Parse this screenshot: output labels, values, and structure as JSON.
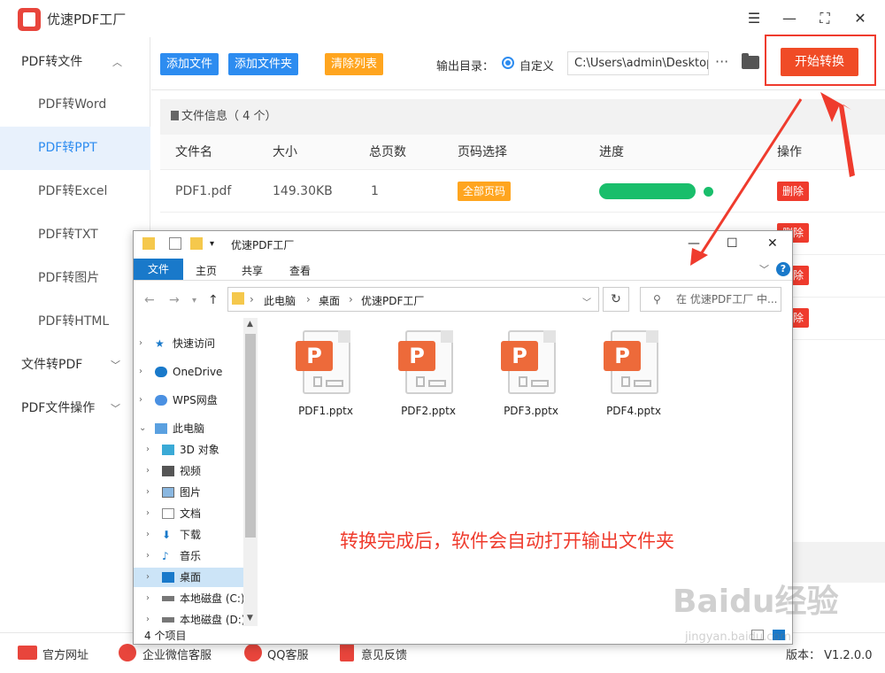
{
  "app": {
    "title": "优速PDF工厂",
    "accent": "#2d8cf0",
    "danger": "#ef3b2d"
  },
  "sidebar": {
    "groups": [
      {
        "label": "PDF转文件",
        "chevron": "chevron-up-icon"
      },
      {
        "label": "文件转PDF",
        "chevron": "chevron-down-icon"
      },
      {
        "label": "PDF文件操作",
        "chevron": "chevron-down-icon"
      }
    ],
    "items": [
      "PDF转Word",
      "PDF转PPT",
      "PDF转Excel",
      "PDF转TXT",
      "PDF转图片",
      "PDF转HTML"
    ],
    "active": "PDF转PPT"
  },
  "toolbar": {
    "add_file": "添加文件",
    "add_folder": "添加文件夹",
    "clear_list": "清除列表",
    "output_label": "输出目录：",
    "custom_label": "自定义",
    "output_path": "C:\\Users\\admin\\Desktop",
    "more": "···",
    "start": "开始转换"
  },
  "file_info": {
    "label": "文件信息（ 4 个）"
  },
  "table": {
    "headers": [
      "文件名",
      "大小",
      "总页数",
      "页码选择",
      "进度",
      "操作"
    ],
    "rows": [
      {
        "name": "PDF1.pdf",
        "size": "149.30KB",
        "pages": "1",
        "page_select": "全部页码",
        "progress": 1.0,
        "action": "删除"
      }
    ],
    "hidden_rows_actions": [
      "删除",
      "删除",
      "删除"
    ]
  },
  "bottombar": {
    "links": [
      "官方网址",
      "企业微信客服",
      "QQ客服",
      "意见反馈"
    ],
    "version": "版本： V1.2.0.0"
  },
  "explorer": {
    "title": "优速PDF工厂",
    "ribbon": {
      "file": "文件",
      "tabs": [
        "主页",
        "共享",
        "查看"
      ]
    },
    "address": [
      "此电脑",
      "桌面",
      "优速PDF工厂"
    ],
    "search_placeholder": "在 优速PDF工厂 中...",
    "nav": [
      {
        "label": "快速访问",
        "level": 0,
        "icon": "star-icon"
      },
      {
        "label": "OneDrive",
        "level": 0,
        "icon": "cloud-icon"
      },
      {
        "label": "WPS网盘",
        "level": 0,
        "icon": "cloud-icon"
      },
      {
        "label": "此电脑",
        "level": 0,
        "icon": "computer-icon",
        "expanded": true
      },
      {
        "label": "3D 对象",
        "level": 1,
        "icon": "cube-icon"
      },
      {
        "label": "视频",
        "level": 1,
        "icon": "video-icon"
      },
      {
        "label": "图片",
        "level": 1,
        "icon": "picture-icon"
      },
      {
        "label": "文档",
        "level": 1,
        "icon": "document-icon"
      },
      {
        "label": "下载",
        "level": 1,
        "icon": "download-icon"
      },
      {
        "label": "音乐",
        "level": 1,
        "icon": "music-icon"
      },
      {
        "label": "桌面",
        "level": 1,
        "icon": "desktop-icon",
        "selected": true
      },
      {
        "label": "本地磁盘 (C:)",
        "level": 1,
        "icon": "drive-icon"
      },
      {
        "label": "本地磁盘 (D:)",
        "level": 1,
        "icon": "drive-icon"
      }
    ],
    "files": [
      "PDF1.pptx",
      "PDF2.pptx",
      "PDF3.pptx",
      "PDF4.pptx"
    ],
    "file_icon_letter": "P",
    "status": "4 个项目",
    "notice": "转换完成后，软件会自动打开输出文件夹"
  },
  "watermark": {
    "text": "Baidu经验",
    "sub": "jingyan.baidu.com"
  }
}
